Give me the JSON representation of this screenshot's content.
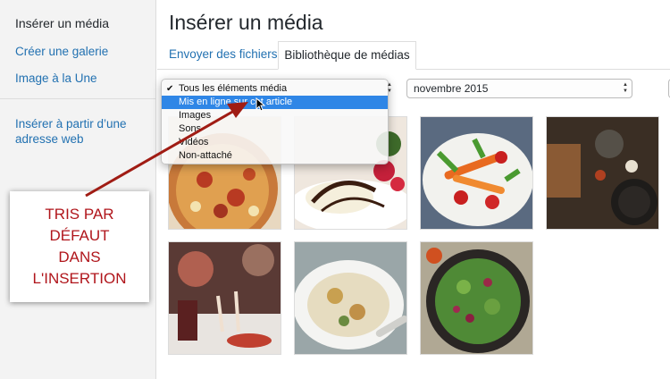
{
  "sidebar": {
    "active": "Insérer un média",
    "links": [
      "Créer une galerie",
      "Image à la Une",
      "Insérer à partir d’une adresse web"
    ]
  },
  "callout": {
    "text": "TRIS PAR\nDÉFAUT\nDANS\nL'INSERTION"
  },
  "main": {
    "title": "Insérer un média",
    "tabs": [
      {
        "label": "Envoyer des fichiers",
        "active": false
      },
      {
        "label": "Bibliothèque de médias",
        "active": true
      }
    ]
  },
  "filter": {
    "options": [
      "Tous les éléments média",
      "Mis en ligne sur cet article",
      "Images",
      "Sons",
      "Vidéos",
      "Non-attaché"
    ],
    "checked_index": 0,
    "highlighted_index": 1
  },
  "date_filter": {
    "selected": "novembre 2015"
  },
  "media_thumbnails": [
    {
      "icon": "pizza-photo"
    },
    {
      "icon": "dessert-photo"
    },
    {
      "icon": "salad-vegetables-photo"
    },
    {
      "icon": "kitchen-table-photo"
    },
    {
      "icon": "dinner-table-photo"
    },
    {
      "icon": "soup-bowl-photo"
    },
    {
      "icon": "green-salad-bowl-photo"
    }
  ],
  "colors": {
    "accent": "#2271b1",
    "callout_text": "#b0151b",
    "arrow": "#a01c14",
    "highlight": "#2f86e6"
  }
}
